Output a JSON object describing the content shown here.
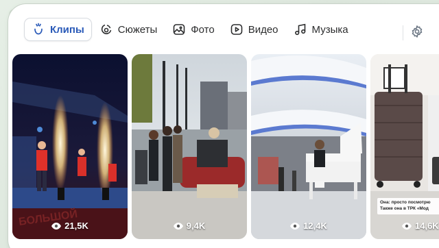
{
  "tabs": [
    {
      "label": "Клипы",
      "icon": "clips-icon",
      "active": true
    },
    {
      "label": "Сюжеты",
      "icon": "stories-icon",
      "active": false
    },
    {
      "label": "Фото",
      "icon": "photo-icon",
      "active": false
    },
    {
      "label": "Видео",
      "icon": "video-icon",
      "active": false
    },
    {
      "label": "Музыка",
      "icon": "music-icon",
      "active": false
    }
  ],
  "settings_icon": "gear-icon",
  "clips": [
    {
      "views": "21,5K",
      "scene": "concert stage with sparkler fountains"
    },
    {
      "views": "9,4K",
      "scene": "people on outdoor terrace with car"
    },
    {
      "views": "12,4K",
      "scene": "shopping mall atrium with white piano"
    },
    {
      "views": "14,6K",
      "scene": "suitcase in shop",
      "caption_line1": "Она: просто посмотрю",
      "caption_line2": "Также она в ТРК «Мод"
    }
  ],
  "colors": {
    "accent": "#2a5ab8",
    "text": "#2c2d2e"
  }
}
